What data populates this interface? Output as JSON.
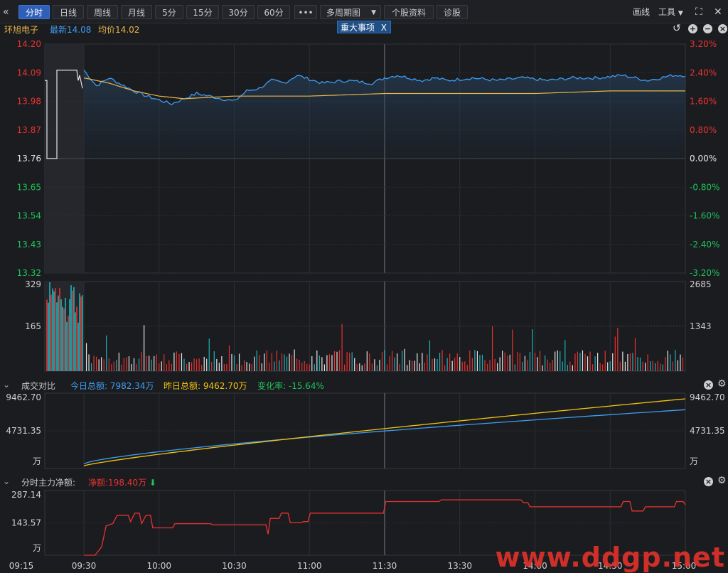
{
  "toolbar": {
    "back_icon": "double-chevron-left-icon",
    "tabs": [
      "分时",
      "日线",
      "周线",
      "月线",
      "5分",
      "15分",
      "30分",
      "60分"
    ],
    "more_label": "•••",
    "multi_period": "多周期图",
    "stock_info": "个股资料",
    "diagnosis": "诊股",
    "draw": "画线",
    "tools": "工具"
  },
  "quote": {
    "name": "环旭电子",
    "latest_label": "最新",
    "latest_value": "14.08",
    "avg_label": "均价",
    "avg_value": "14.02",
    "event_button": "重大事项",
    "event_close": "X"
  },
  "colors": {
    "up": "#e8322f",
    "down": "#1fc25a",
    "price_line": "#3f9cf0",
    "avg_line": "#e8b548",
    "today_line": "#3f9cf0",
    "yesterday_line": "#f1c40f",
    "netflow_line": "#e8322f",
    "volume_cyan": "#1fb2b8"
  },
  "chart_data": [
    {
      "type": "line",
      "name": "intraday-price",
      "y_axis_left": [
        "14.20",
        "14.09",
        "13.98",
        "13.87",
        "13.76",
        "13.65",
        "13.54",
        "13.43",
        "13.32"
      ],
      "y_axis_right": [
        "3.20%",
        "2.40%",
        "1.60%",
        "0.80%",
        "0.00%",
        "-0.80%",
        "-1.60%",
        "-2.40%",
        "-3.20%"
      ],
      "ylim": [
        13.32,
        14.2
      ],
      "prev_close": 13.76,
      "series": [
        {
          "name": "最新",
          "x": [
            0,
            5,
            10,
            20,
            25,
            35,
            45,
            60,
            65,
            70,
            75,
            80,
            85,
            95,
            105,
            115,
            120,
            125,
            130,
            135,
            140,
            145,
            155,
            165,
            175,
            185,
            195,
            205,
            215,
            225,
            230,
            235,
            240
          ],
          "values": [
            14.1,
            14.04,
            14.07,
            14.02,
            14.0,
            13.97,
            14.01,
            13.98,
            14.02,
            14.03,
            14.06,
            14.05,
            14.08,
            14.05,
            14.06,
            14.05,
            14.07,
            14.08,
            14.07,
            14.06,
            14.07,
            14.06,
            14.07,
            14.06,
            14.07,
            14.06,
            14.07,
            14.07,
            14.08,
            14.06,
            14.07,
            14.08,
            14.08
          ]
        },
        {
          "name": "均价",
          "x": [
            0,
            10,
            20,
            30,
            40,
            60,
            90,
            120,
            150,
            180,
            210,
            240
          ],
          "values": [
            14.07,
            14.05,
            14.02,
            14.0,
            13.99,
            14.0,
            14.0,
            14.01,
            14.01,
            14.01,
            14.02,
            14.02
          ]
        }
      ]
    },
    {
      "type": "bar",
      "name": "volume",
      "y_axis_left": [
        "329",
        "165"
      ],
      "y_axis_right": [
        "2685",
        "1343"
      ],
      "ylim": [
        0,
        329
      ]
    },
    {
      "type": "line",
      "name": "turnover-compare",
      "header": "成交对比",
      "today_label": "今日总额:",
      "today_value": "7982.34万",
      "yesterday_label": "昨日总额:",
      "yesterday_value": "9462.70万",
      "change_label": "变化率:",
      "change_value": "-15.64%",
      "y_axis_left": [
        "9462.70",
        "4731.35",
        "万"
      ],
      "y_axis_right": [
        "9462.70",
        "4731.35",
        "万"
      ],
      "ylim": [
        0,
        9462.7
      ]
    },
    {
      "type": "line",
      "name": "net-main-inflow",
      "header": "分时主力净额:",
      "net_label": "净额:",
      "net_value": "198.40万",
      "y_axis_left": [
        "287.14",
        "143.57",
        "万"
      ],
      "ylim": [
        0,
        287.14
      ]
    }
  ],
  "time_axis": [
    "09:15",
    "09:30",
    "10:00",
    "10:30",
    "11:00",
    "11:30",
    "13:30",
    "14:00",
    "14:30",
    "15:00"
  ],
  "watermark": "www.ddgp.net"
}
